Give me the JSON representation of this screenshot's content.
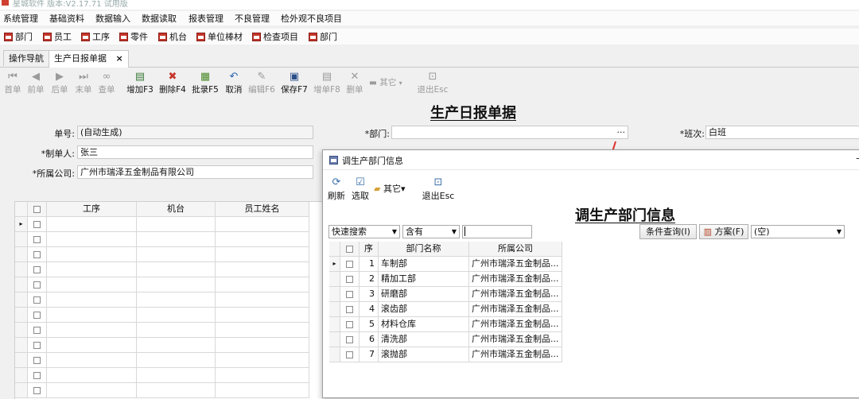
{
  "window": {
    "title": "星城软件 版本:V2.17.71 试用版"
  },
  "menu": [
    "系统管理",
    "基础资料",
    "数据输入",
    "数据读取",
    "报表管理",
    "不良管理",
    "检外观不良项目"
  ],
  "quickbar": [
    "部门",
    "员工",
    "工序",
    "零件",
    "机台",
    "单位棒材",
    "检查项目",
    "部门"
  ],
  "tabs": [
    {
      "label": "操作导航"
    },
    {
      "label": "生产日报单据",
      "close": "×"
    }
  ],
  "toolbar": [
    {
      "label": "首单",
      "icon": "first-icon",
      "enabled": false
    },
    {
      "label": "前单",
      "icon": "prev-icon",
      "enabled": false
    },
    {
      "label": "后单",
      "icon": "next-icon",
      "enabled": false
    },
    {
      "label": "末单",
      "icon": "last-icon",
      "enabled": false
    },
    {
      "label": "查单",
      "icon": "binoculars-icon",
      "enabled": false
    },
    {
      "label": "增加F3",
      "icon": "add-doc-icon",
      "enabled": true
    },
    {
      "label": "删除F4",
      "icon": "delete-icon",
      "enabled": true
    },
    {
      "label": "批录F5",
      "icon": "batch-icon",
      "enabled": true
    },
    {
      "label": "取消",
      "icon": "undo-icon",
      "enabled": true
    },
    {
      "label": "编辑F6",
      "icon": "edit-icon",
      "enabled": false
    },
    {
      "label": "保存F7",
      "icon": "save-icon",
      "enabled": true
    },
    {
      "label": "增单F8",
      "icon": "add-order-icon",
      "enabled": false
    },
    {
      "label": "删单",
      "icon": "delete-order-icon",
      "enabled": false
    },
    {
      "label": "其它",
      "icon": "other-icon",
      "enabled": false
    },
    {
      "label": "退出Esc",
      "icon": "exit-icon",
      "enabled": false
    }
  ],
  "form": {
    "heading": "生产日报单据",
    "order_no_label": "单号:",
    "order_no_value": "(自动生成)",
    "maker_label": "*制单人:",
    "maker_value": "张三",
    "company_label": "*所属公司:",
    "company_value": "广州市瑞泽五金制品有限公司",
    "dept_label": "*部门:",
    "dept_value": "",
    "dept_ellipsis": "···",
    "shift_label": "*班次:",
    "shift_value": "白班"
  },
  "main_grid": {
    "columns": [
      "工序",
      "机台",
      "员工姓名"
    ],
    "row_indicator": "▸"
  },
  "dialog": {
    "title": "调生产部门信息",
    "buttons": [
      {
        "label": "刷新",
        "icon": "refresh-icon"
      },
      {
        "label": "选取",
        "icon": "select-icon"
      },
      {
        "label": "其它",
        "icon": "folder-icon",
        "dropdown": "▾"
      },
      {
        "label": "退出Esc",
        "icon": "exit-icon"
      }
    ],
    "heading": "调生产部门信息",
    "search": {
      "mode": "快速搜索",
      "match": "含有",
      "query": "",
      "condition_button": "条件查询(I)",
      "plan_button": "方案(F)",
      "plan_value": "(空)"
    },
    "grid": {
      "columns": [
        "序",
        "部门名称",
        "所属公司"
      ],
      "rows": [
        {
          "no": "1",
          "name": "车制部",
          "company": "广州市瑞泽五金制品..."
        },
        {
          "no": "2",
          "name": "精加工部",
          "company": "广州市瑞泽五金制品..."
        },
        {
          "no": "3",
          "name": "研磨部",
          "company": "广州市瑞泽五金制品..."
        },
        {
          "no": "4",
          "name": "滚齿部",
          "company": "广州市瑞泽五金制品..."
        },
        {
          "no": "5",
          "name": "材料仓库",
          "company": "广州市瑞泽五金制品..."
        },
        {
          "no": "6",
          "name": "清洗部",
          "company": "广州市瑞泽五金制品..."
        },
        {
          "no": "7",
          "name": "滚抛部",
          "company": "广州市瑞泽五金制品..."
        }
      ]
    }
  },
  "colors": {
    "accent_red": "#c6352a",
    "arrow_red": "#e0302a",
    "save_blue": "#2a4f8a"
  }
}
